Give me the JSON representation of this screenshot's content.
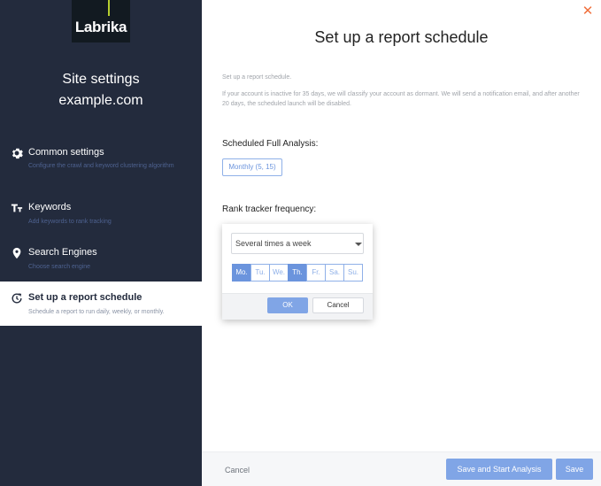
{
  "brand": {
    "logo_text": "Labrika"
  },
  "sidebar": {
    "title": "Site settings",
    "domain": "example.com",
    "items": [
      {
        "label": "Common settings",
        "desc": "Configure the crawl and keyword clustering algorithm",
        "icon": "gear-icon"
      },
      {
        "label": "Keywords",
        "desc": "Add keywords to rank tracking",
        "icon": "text-size-icon"
      },
      {
        "label": "Search Engines",
        "desc": "Choose search engine",
        "icon": "location-pin-icon"
      },
      {
        "label": "Set up a report schedule",
        "desc": "Schedule a report to run daily, weekly, or monthly.",
        "icon": "clock-refresh-icon",
        "active": true
      }
    ]
  },
  "main": {
    "title": "Set up a report schedule",
    "intro": "Set up a report schedule.",
    "description": "If your account is inactive for 35 days, we will classify your account as dormant. We will send a notification email, and after another 20 days, the scheduled launch will be disabled.",
    "full_analysis_label": "Scheduled Full Analysis:",
    "full_analysis_chip": "Monthly (5, 15)",
    "rank_tracker_label": "Rank tracker frequency:"
  },
  "popup": {
    "select_value": "Several times a week",
    "days": [
      {
        "label": "Mo.",
        "selected": true
      },
      {
        "label": "Tu.",
        "selected": false
      },
      {
        "label": "We.",
        "selected": false
      },
      {
        "label": "Th.",
        "selected": true
      },
      {
        "label": "Fr.",
        "selected": false
      },
      {
        "label": "Sa.",
        "selected": false
      },
      {
        "label": "Su.",
        "selected": false
      }
    ],
    "ok_label": "OK",
    "cancel_label": "Cancel"
  },
  "footer": {
    "cancel_label": "Cancel",
    "save_start_label": "Save and Start Analysis",
    "save_label": "Save"
  },
  "colors": {
    "sidebar_bg": "#232b3d",
    "accent": "#6b94dd",
    "close": "#f0703d",
    "logo_accent": "#b6cf2f"
  }
}
